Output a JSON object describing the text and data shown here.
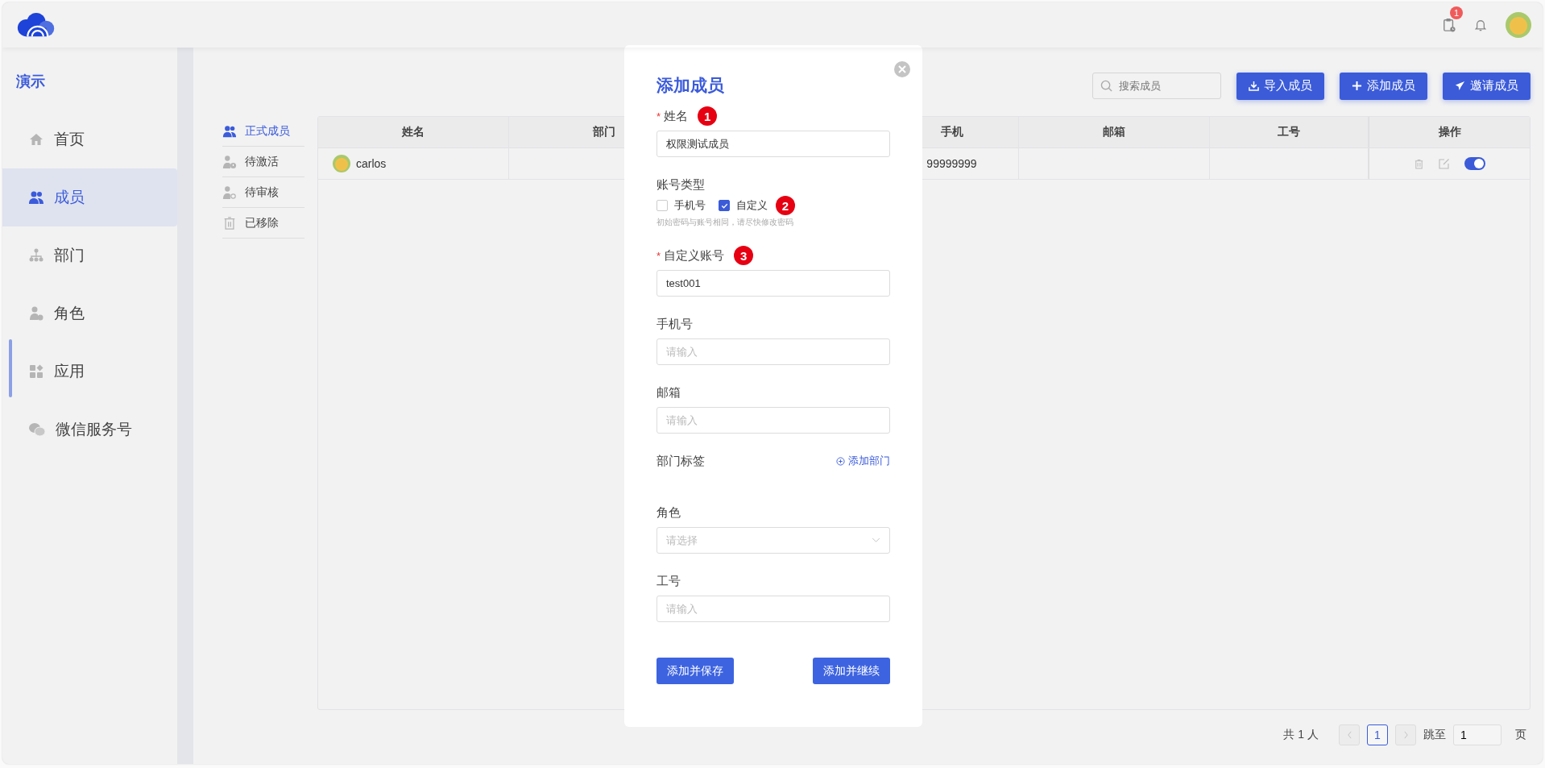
{
  "header": {
    "notification_badge": "1"
  },
  "sidebar": {
    "title": "演示",
    "items": [
      {
        "label": "首页",
        "selected": false
      },
      {
        "label": "成员",
        "selected": true
      },
      {
        "label": "部门",
        "selected": false
      },
      {
        "label": "角色",
        "selected": false
      },
      {
        "label": "应用",
        "selected": false
      },
      {
        "label": "微信服务号",
        "selected": false
      }
    ]
  },
  "subnav": [
    {
      "label": "正式成员",
      "selected": true
    },
    {
      "label": "待激活",
      "selected": false
    },
    {
      "label": "待审核",
      "selected": false
    },
    {
      "label": "已移除",
      "selected": false
    }
  ],
  "toolbar": {
    "search": {
      "placeholder": "搜索成员"
    },
    "buttons": [
      {
        "label": "导入成员"
      },
      {
        "label": "添加成员"
      },
      {
        "label": "邀请成员"
      }
    ]
  },
  "table": {
    "columns": [
      "姓名",
      "部门",
      "手机",
      "邮箱",
      "工号",
      "操作"
    ],
    "rows": [
      {
        "name": "carlos",
        "phone": "99999999",
        "enabled": true
      }
    ]
  },
  "pagination": {
    "total": "共 1 人",
    "pages": [
      {
        "label": "1",
        "selected": true
      }
    ],
    "jump_label": "跳至",
    "jump_value": "1",
    "page_suffix": "页"
  },
  "dialog": {
    "title": "添加成员",
    "fields": [
      {
        "kind": "text",
        "label": "姓名",
        "required_mark": "*",
        "marker": "1",
        "value": "权限测试成员"
      },
      {
        "kind": "checkboxes",
        "label": "账号类型",
        "marker": "2",
        "options": [
          {
            "label": "手机号",
            "checked": false
          },
          {
            "label": "自定义",
            "checked": true
          }
        ],
        "hint": "初始密码与账号相同，请尽快修改密码"
      },
      {
        "kind": "text",
        "label": "自定义账号",
        "required_mark": "*",
        "marker": "3",
        "value": "test001"
      },
      {
        "kind": "text",
        "label": "手机号",
        "placeholder": "请输入"
      },
      {
        "kind": "text",
        "label": "邮箱",
        "placeholder": "请输入"
      },
      {
        "kind": "tags",
        "label": "部门标签",
        "action": "添加部门"
      },
      {
        "kind": "select",
        "label": "角色",
        "placeholder": "请选择"
      },
      {
        "kind": "text",
        "label": "工号",
        "placeholder": "请输入"
      }
    ],
    "buttons": [
      "添加并保存",
      "添加并继续"
    ]
  }
}
